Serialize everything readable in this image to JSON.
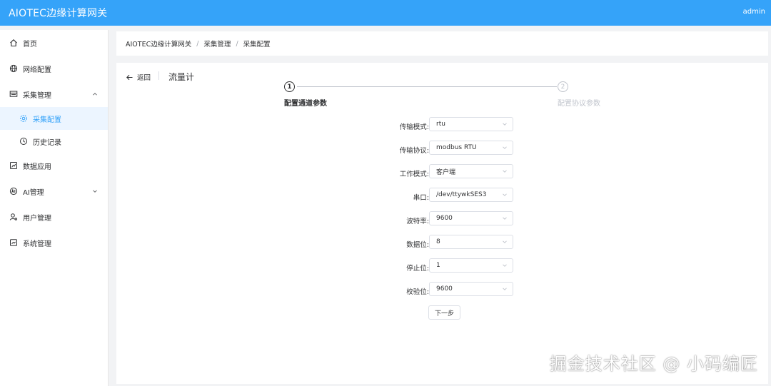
{
  "header": {
    "app_title": "AIOTEC边缘计算网关",
    "user": "admin"
  },
  "sidebar": {
    "items": [
      {
        "label": "首页",
        "icon": "home-icon"
      },
      {
        "label": "网络配置",
        "icon": "globe-icon"
      },
      {
        "label": "采集管理",
        "icon": "collect-icon",
        "expanded": true
      },
      {
        "label": "采集配置",
        "icon": "gear-icon",
        "active": true
      },
      {
        "label": "历史记录",
        "icon": "history-icon"
      },
      {
        "label": "数据应用",
        "icon": "data-app-icon"
      },
      {
        "label": "AI管理",
        "icon": "ai-icon",
        "expanded": false
      },
      {
        "label": "用户管理",
        "icon": "user-icon"
      },
      {
        "label": "系统管理",
        "icon": "system-icon"
      }
    ]
  },
  "breadcrumb": {
    "items": [
      "AIOTEC边缘计算网关",
      "采集管理",
      "采集配置"
    ],
    "separator": "/"
  },
  "page": {
    "back_label": "返回",
    "title": "流量计"
  },
  "steps": [
    {
      "number": "1",
      "label": "配置通道参数",
      "status": "active"
    },
    {
      "number": "2",
      "label": "配置协议参数",
      "status": "pending"
    }
  ],
  "form": {
    "fields": [
      {
        "label": "传输模式:",
        "value": "rtu"
      },
      {
        "label": "传输协议:",
        "value": "modbus RTU"
      },
      {
        "label": "工作模式:",
        "value": "客户端"
      },
      {
        "label": "串口:",
        "value": "/dev/ttywkSES3"
      },
      {
        "label": "波特率:",
        "value": "9600"
      },
      {
        "label": "数据位:",
        "value": "8"
      },
      {
        "label": "停止位:",
        "value": "1"
      },
      {
        "label": "校验位:",
        "value": "9600"
      }
    ],
    "next_label": "下一步"
  },
  "watermark": "掘金技术社区 @ 小码编匠",
  "colors": {
    "primary": "#35a3f9",
    "active_bg": "#ecf5ff",
    "muted": "#c0c4cc"
  }
}
